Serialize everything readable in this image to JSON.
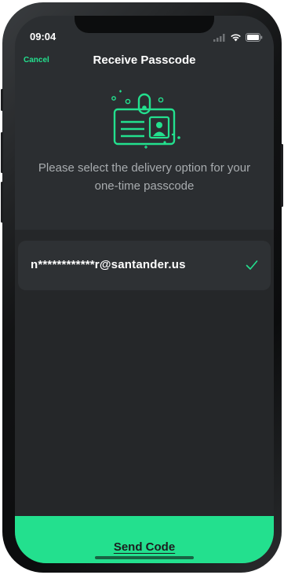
{
  "status_bar": {
    "time": "09:04"
  },
  "header": {
    "cancel_label": "Cancel",
    "title": "Receive Passcode"
  },
  "hero": {
    "icon": "id-badge-icon",
    "instructions": "Please select the delivery option for your one-time passcode"
  },
  "delivery_options": [
    {
      "label": "n************r@santander.us",
      "selected": true
    }
  ],
  "footer": {
    "send_label": "Send Code"
  },
  "colors": {
    "accent": "#23e08e",
    "background": "#2b2e31",
    "list_background": "#252729",
    "row": "#2e3134"
  }
}
